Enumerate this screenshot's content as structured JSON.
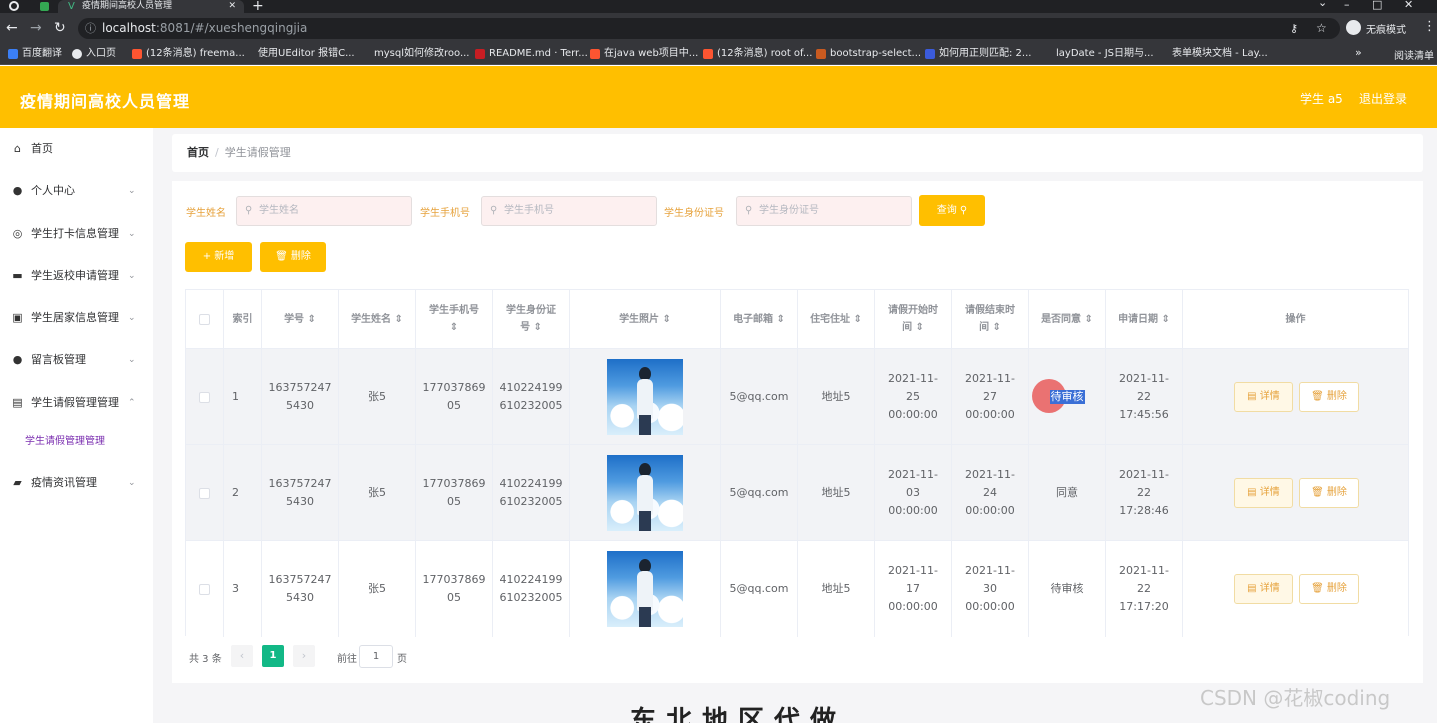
{
  "browser": {
    "tabs": [
      {
        "title": ""
      },
      {
        "title": "疫情期间高校人员管理"
      }
    ],
    "new_tab": "+",
    "window_controls": [
      "⌄",
      "–",
      "□",
      "✕"
    ],
    "address": {
      "host": "localhost",
      "rest": ":8081/#/xueshengqingjia"
    },
    "incognito": "无痕模式",
    "bookmarks": [
      "百度翻译",
      "入口页",
      "(12条消息) freema...",
      "使用UEditor 报错C...",
      "mysql如何修改roo...",
      "README.md · Terr...",
      "在java web项目中...",
      "(12条消息) root of...",
      "bootstrap-select...",
      "如何用正则匹配: 2...",
      "layDate - JS日期与...",
      "表单模块文档 - Lay..."
    ],
    "bm_more": "»",
    "reading_list": "阅读清单"
  },
  "header": {
    "title": "疫情期间高校人员管理",
    "user": "学生 a5",
    "logout": "退出登录"
  },
  "sidebar": {
    "items": [
      {
        "label": "首页",
        "icon": "home-icon",
        "glyph": "⌂",
        "arrow": ""
      },
      {
        "label": "个人中心",
        "icon": "user-icon",
        "glyph": "●",
        "arrow": "⌄"
      },
      {
        "label": "学生打卡信息管理",
        "icon": "target-icon",
        "glyph": "◎",
        "arrow": "⌄"
      },
      {
        "label": "学生返校申请管理",
        "icon": "briefcase-icon",
        "glyph": "▬",
        "arrow": "⌄"
      },
      {
        "label": "学生居家信息管理",
        "icon": "chart-icon",
        "glyph": "▣",
        "arrow": "⌄"
      },
      {
        "label": "留言板管理",
        "icon": "bulb-icon",
        "glyph": "●",
        "arrow": "⌄"
      },
      {
        "label": "学生请假管理管理",
        "icon": "clipboard-icon",
        "glyph": "▤",
        "arrow": "⌃"
      },
      {
        "label": "疫情资讯管理",
        "icon": "thumb-icon",
        "glyph": "▰",
        "arrow": "⌄"
      }
    ],
    "active_sub": "学生请假管理管理"
  },
  "breadcrumb": {
    "home": "首页",
    "sep": "/",
    "current": "学生请假管理"
  },
  "filters": {
    "name_label": "学生姓名",
    "name_placeholder": "学生姓名",
    "phone_label": "学生手机号",
    "phone_placeholder": "学生手机号",
    "id_label": "学生身份证号",
    "id_placeholder": "学生身份证号",
    "search_icon": "⚲",
    "query": "查询 ⚲"
  },
  "actions": {
    "add": "+ 新增",
    "delete": "🗑 删除"
  },
  "table": {
    "sort_icon": "⇕",
    "headers": [
      "",
      "索引",
      "学号",
      "学生姓名",
      "学生手机号",
      "学生身份证号",
      "学生照片",
      "电子邮箱",
      "住宅住址",
      "请假开始时间",
      "请假结束时间",
      "是否同意",
      "申请日期",
      "操作"
    ],
    "header_lines": {
      "xh": "学号 ⇕",
      "name": "学生姓名 ⇕",
      "phone1": "学生手机号",
      "phone2": "⇕",
      "id1": "学生身份证",
      "id2": "号 ⇕",
      "photo": "学生照片 ⇕",
      "email": "电子邮箱 ⇕",
      "addr": "住宅住址 ⇕",
      "start1": "请假开始时",
      "start2": "间 ⇕",
      "end1": "请假结束时",
      "end2": "间 ⇕",
      "agree": "是否同意 ⇕",
      "date": "申请日期 ⇕"
    },
    "rows": [
      {
        "index": "1",
        "xh1": "163757247",
        "xh2": "5430",
        "name": "张5",
        "phone1": "177037869",
        "phone2": "05",
        "id1": "410224199",
        "id2": "610232005",
        "email": "5@qq.com",
        "addr": "地址5",
        "start1": "2021-11-25",
        "start2": "00:00:00",
        "end1": "2021-11-27",
        "end2": "00:00:00",
        "agree": "待审核",
        "date1": "2021-11-22",
        "date2": "17:45:56"
      },
      {
        "index": "2",
        "xh1": "163757247",
        "xh2": "5430",
        "name": "张5",
        "phone1": "177037869",
        "phone2": "05",
        "id1": "410224199",
        "id2": "610232005",
        "email": "5@qq.com",
        "addr": "地址5",
        "start1": "2021-11-03",
        "start2": "00:00:00",
        "end1": "2021-11-24",
        "end2": "00:00:00",
        "agree": "同意",
        "date1": "2021-11-22",
        "date2": "17:28:46"
      },
      {
        "index": "3",
        "xh1": "163757247",
        "xh2": "5430",
        "name": "张5",
        "phone1": "177037869",
        "phone2": "05",
        "id1": "410224199",
        "id2": "610232005",
        "email": "5@qq.com",
        "addr": "地址5",
        "start1": "2021-11-17",
        "start2": "00:00:00",
        "end1": "2021-11-30",
        "end2": "00:00:00",
        "agree": "待审核",
        "date1": "2021-11-22",
        "date2": "17:17:20"
      }
    ],
    "detail": "▤ 详情",
    "remove": "🗑 删除"
  },
  "pagination": {
    "total": "共 3 条",
    "prev": "‹",
    "current": "1",
    "next": "›",
    "goto_prefix": "前往",
    "goto_value": "1",
    "goto_suffix": "页"
  },
  "watermark": "CSDN @花椒coding",
  "bottom_text": "东北地区代做"
}
